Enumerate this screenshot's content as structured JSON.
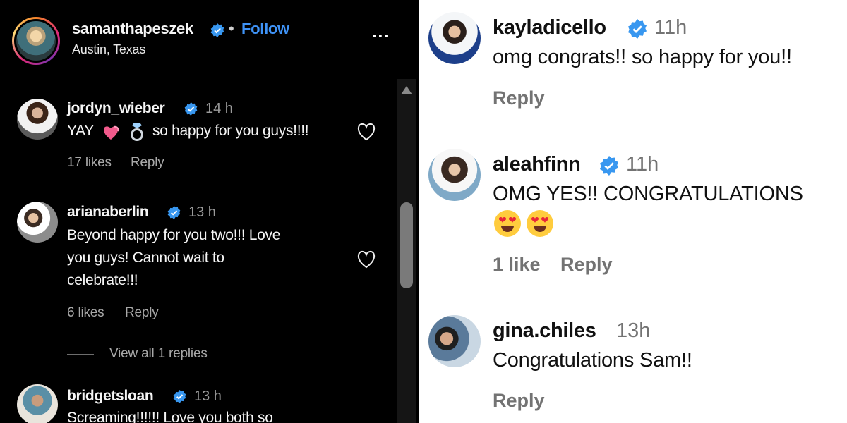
{
  "left_panel": {
    "header": {
      "username": "samanthapeszek",
      "separator": "•",
      "follow_label": "Follow",
      "location": "Austin, Texas",
      "more_label": "..."
    },
    "comments": [
      {
        "username": "jordyn_wieber",
        "time": "14 h",
        "text_parts": [
          "YAY",
          "so happy for you guys!!!!"
        ],
        "emojis": [
          "heart-emoji",
          "ring-emoji"
        ],
        "likes": "17 likes",
        "reply_label": "Reply"
      },
      {
        "username": "arianaberlin",
        "time": "13 h",
        "text_lines": [
          "Beyond happy for you two!!! Love",
          "you guys! Cannot wait to",
          "celebrate!!!"
        ],
        "likes": "6 likes",
        "reply_label": "Reply",
        "view_replies": "View all 1 replies"
      },
      {
        "username": "bridgetsloan",
        "time": "13 h",
        "text": "Screaming!!!!!! Love you both so"
      }
    ]
  },
  "right_panel": {
    "comments": [
      {
        "username": "kayladicello",
        "time": "11h",
        "text": "omg congrats!! so happy for you!!",
        "reply_label": "Reply"
      },
      {
        "username": "aleahfinn",
        "time": "11h",
        "text": "OMG YES!! CONGRATULATIONS",
        "emojis": [
          "heart-eyes-emoji",
          "heart-eyes-emoji"
        ],
        "likes": "1 like",
        "reply_label": "Reply"
      },
      {
        "username": "gina.chiles",
        "time": "13h",
        "text": "Congratulations Sam!!",
        "reply_label": "Reply"
      }
    ]
  },
  "colors": {
    "follow_blue": "#3f93f7",
    "verified_blue": "#3897f0",
    "dark_bg": "#000000",
    "muted_text_light": "#737373"
  }
}
